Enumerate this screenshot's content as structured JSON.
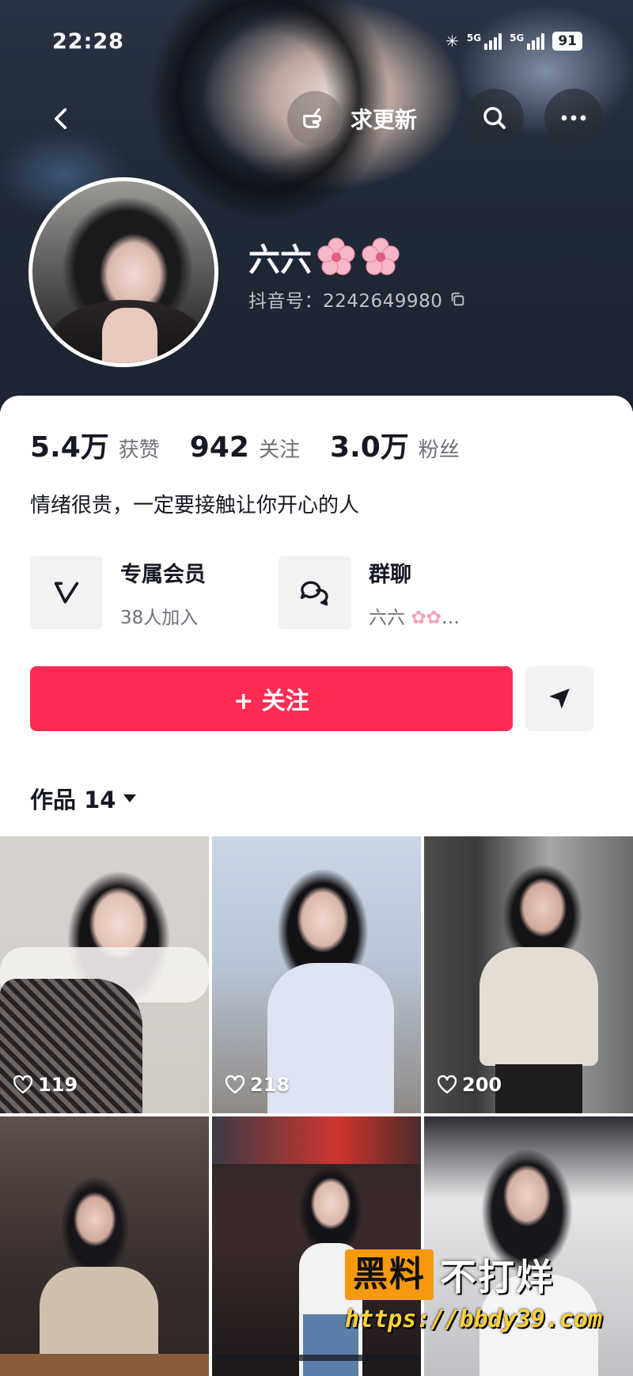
{
  "status_bar": {
    "time": "22:28",
    "network_1": "5G",
    "network_2": "5G",
    "battery": "91"
  },
  "top_nav": {
    "request_update_label": "求更新"
  },
  "profile": {
    "name": "六六",
    "douyin_id": "抖音号：2242649980"
  },
  "stats": [
    {
      "value": "5.4万",
      "label": "获赞"
    },
    {
      "value": "942",
      "label": "关注"
    },
    {
      "value": "3.0万",
      "label": "粉丝"
    }
  ],
  "bio": "情绪很贵，一定要接触让你开心的人",
  "features": {
    "member": {
      "title": "专属会员",
      "subtitle": "38人加入"
    },
    "group": {
      "title": "群聊",
      "subtitle": "六六"
    }
  },
  "actions": {
    "follow_label": "+ 关注"
  },
  "works_tab": {
    "label": "作品 14"
  },
  "videos": [
    {
      "likes": "119"
    },
    {
      "likes": "218"
    },
    {
      "likes": "200"
    },
    {
      "likes": ""
    },
    {
      "likes": ""
    },
    {
      "likes": ""
    }
  ],
  "watermark": {
    "badge": "黑料",
    "text": "不打烊",
    "url": "https://bbdy39.com"
  },
  "colors": {
    "follow_accent": "#fe2c55",
    "watermark_orange": "#f59a0f"
  }
}
